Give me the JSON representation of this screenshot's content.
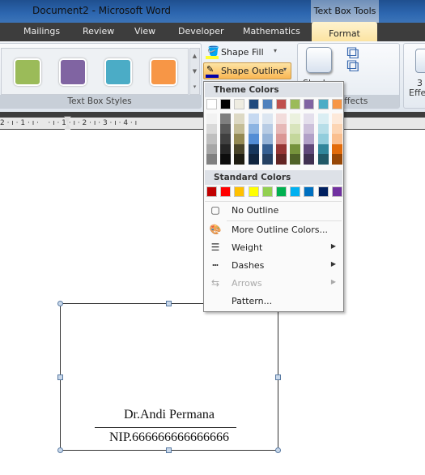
{
  "window": {
    "title": "Document2 - Microsoft Word",
    "context_tab": "Text Box Tools"
  },
  "tabs": [
    "Mailings",
    "Review",
    "View",
    "Developer",
    "Mathematics",
    "Format"
  ],
  "ribbon": {
    "styles_group": "Text Box Styles",
    "style_colors": [
      "#9BBB59",
      "#8064A2",
      "#4BACC6",
      "#F79646"
    ],
    "shape_fill": "Shape Fill",
    "shape_outline": "Shape Outline",
    "shadow": "Shadow",
    "shadow_effects_group": "w Effects",
    "effects_3d": "3",
    "effects_3d_label": "Effe"
  },
  "ruler": "2 · ı · 1 · ı ·    · ı · 1 · ı · 2 · ı · 3 · ı · 4 · ı                                                          · ı · 10 · ı · 11 · ı",
  "menu": {
    "theme_header": "Theme Colors",
    "theme_base": [
      "#FFFFFF",
      "#000000",
      "#EEECE1",
      "#1F497D",
      "#4F81BD",
      "#C0504D",
      "#9BBB59",
      "#8064A2",
      "#4BACC6",
      "#F79646"
    ],
    "theme_shades": [
      [
        "#F2F2F2",
        "#D9D9D9",
        "#BFBFBF",
        "#A6A6A6",
        "#808080"
      ],
      [
        "#7F7F7F",
        "#595959",
        "#404040",
        "#262626",
        "#0D0D0D"
      ],
      [
        "#DDD9C4",
        "#C4BD97",
        "#948A54",
        "#4A452A",
        "#1E1C11"
      ],
      [
        "#C6D9F1",
        "#8DB4E2",
        "#538DD5",
        "#16365C",
        "#0F243E"
      ],
      [
        "#DCE6F1",
        "#B8CCE4",
        "#95B3D7",
        "#366092",
        "#244062"
      ],
      [
        "#F2DCDB",
        "#E6B8B7",
        "#DA9694",
        "#963634",
        "#632523"
      ],
      [
        "#EBF1DE",
        "#D8E4BC",
        "#C4D79B",
        "#76933C",
        "#4F6228"
      ],
      [
        "#E4DFEC",
        "#CCC0DA",
        "#B1A0C7",
        "#60497A",
        "#403151"
      ],
      [
        "#DAEEF3",
        "#B7DEE8",
        "#92CDDC",
        "#31869B",
        "#215967"
      ],
      [
        "#FDE9D9",
        "#FCD5B4",
        "#FABF8F",
        "#E26B0A",
        "#974706"
      ]
    ],
    "standard_header": "Standard Colors",
    "standard": [
      "#C00000",
      "#FF0000",
      "#FFC000",
      "#FFFF00",
      "#92D050",
      "#00B050",
      "#00B0F0",
      "#0070C0",
      "#002060",
      "#7030A0"
    ],
    "items": [
      {
        "label": "No Outline",
        "icon": "no-outline-icon"
      },
      {
        "label": "More Outline Colors...",
        "icon": "palette-icon"
      },
      {
        "label": "Weight",
        "icon": "weight-icon",
        "submenu": true
      },
      {
        "label": "Dashes",
        "icon": "dashes-icon",
        "submenu": true
      },
      {
        "label": "Arrows",
        "icon": "arrows-icon",
        "submenu": true,
        "disabled": true
      },
      {
        "label": "Pattern...",
        "icon": "pattern-icon"
      }
    ]
  },
  "document": {
    "name": "Dr.Andi Permana",
    "nip": "NIP.666666666666666"
  }
}
